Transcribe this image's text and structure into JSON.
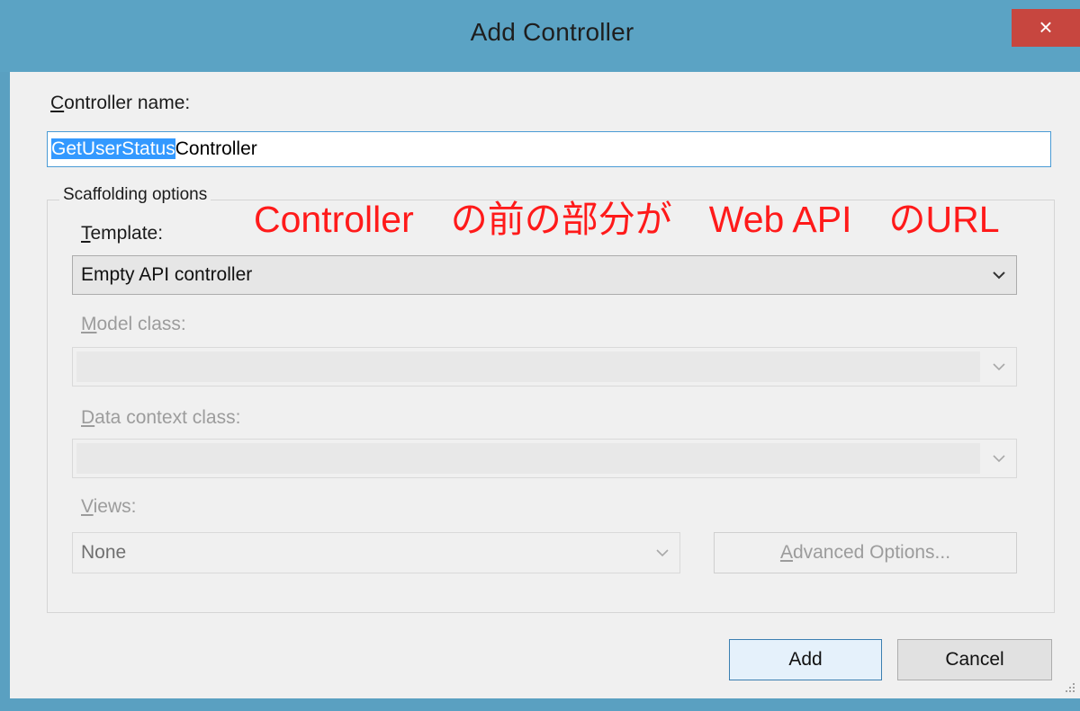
{
  "window": {
    "title": "Add Controller",
    "close_glyph": "×"
  },
  "controller_name": {
    "label_underlined": "C",
    "label_rest": "ontroller name:",
    "value_selected": "GetUserStatus",
    "value_rest": "Controller"
  },
  "scaffolding": {
    "group_title": "Scaffolding options",
    "template": {
      "label_underlined": "T",
      "label_rest": "emplate:",
      "value": "Empty API controller"
    },
    "model_class": {
      "label_underlined": "M",
      "label_rest": "odel class:",
      "value": ""
    },
    "data_context_class": {
      "label_underlined": "D",
      "label_rest": "ata context class:",
      "value": ""
    },
    "views": {
      "label_underlined": "V",
      "label_rest": "iews:",
      "value": "None"
    },
    "advanced_button": {
      "label_underlined": "A",
      "label_rest": "dvanced Options..."
    }
  },
  "annotation": "Controller　の前の部分が　Web API　のURL",
  "buttons": {
    "add": "Add",
    "cancel": "Cancel"
  },
  "colors": {
    "titlebar": "#5ba3c4",
    "close_button": "#c7463f",
    "annotation": "#ff1a1a",
    "selection": "#3399ff"
  },
  "icons": [
    "close-icon",
    "chevron-down-icon",
    "resize-grip-icon"
  ]
}
